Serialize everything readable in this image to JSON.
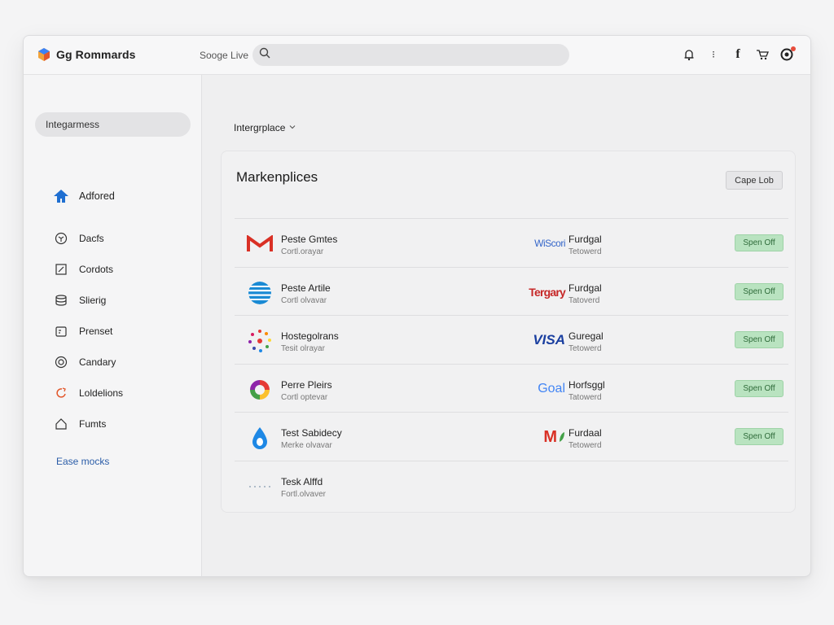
{
  "app": {
    "brand": "Gg Rommards"
  },
  "search": {
    "label": "Sooge Live",
    "placeholder": ""
  },
  "top_icons": [
    "bell-icon",
    "more-icon",
    "facebook-icon",
    "cart-icon",
    "profile-icon"
  ],
  "sidebar": {
    "top_label": "Integarmess",
    "items": [
      {
        "label": "Adfored",
        "icon": "home-icon"
      },
      {
        "label": "Dacfs",
        "icon": "globe-icon"
      },
      {
        "label": "Cordots",
        "icon": "edit-icon"
      },
      {
        "label": "Slierig",
        "icon": "database-icon"
      },
      {
        "label": "Prenset",
        "icon": "calendar-icon"
      },
      {
        "label": "Candary",
        "icon": "target-icon"
      },
      {
        "label": "Loldelions",
        "icon": "link-icon"
      },
      {
        "label": "Fumts",
        "icon": "house-icon"
      }
    ],
    "footer_link": "Ease mocks"
  },
  "main": {
    "dropdown_label": "Intergrplace",
    "panel": {
      "title": "Markenplices",
      "button_label": "Cape Lob",
      "rows": [
        {
          "name": "Peste Gmtes",
          "sub": "Cortl.orayar",
          "logo": "gmail-logo-icon",
          "partner_logo_text": "WiScori",
          "partner_name": "Furdgal",
          "partner_sub": "Tetowerd",
          "action": "Spen Off"
        },
        {
          "name": "Peste Artile",
          "sub": "Cortl olvavar",
          "logo": "att-logo-icon",
          "partner_logo_text": "Tergary",
          "partner_name": "Furdgal",
          "partner_sub": "Tatoverd",
          "action": "Spen Off"
        },
        {
          "name": "Hostegolrans",
          "sub": "Tesit olrayar",
          "logo": "wreath-logo-icon",
          "partner_logo_text": "VISA",
          "partner_name": "Guregal",
          "partner_sub": "Tetowerd",
          "action": "Spen Off"
        },
        {
          "name": "Perre Pleirs",
          "sub": "Cortl optevar",
          "logo": "ring-logo-icon",
          "partner_logo_text": "Goal",
          "partner_name": "Horfsggl",
          "partner_sub": "Tatowerd",
          "action": "Spen Off"
        },
        {
          "name": "Test Sabidecy",
          "sub": "Merke olvavar",
          "logo": "drop-logo-icon",
          "partner_logo_text": "M",
          "partner_name": "Furdaal",
          "partner_sub": "Tetowerd",
          "action": "Spen Off"
        },
        {
          "name": "Tesk Alffd",
          "sub": "Fortl.olvaver",
          "logo": "dots-logo-icon",
          "partner_logo_text": "",
          "partner_name": "",
          "partner_sub": "",
          "action": ""
        }
      ]
    }
  },
  "colors": {
    "accent_green": "#b9e3c0",
    "link_blue": "#2b5da8",
    "visa_blue": "#1a3fa0",
    "gmail_red": "#d93025"
  }
}
